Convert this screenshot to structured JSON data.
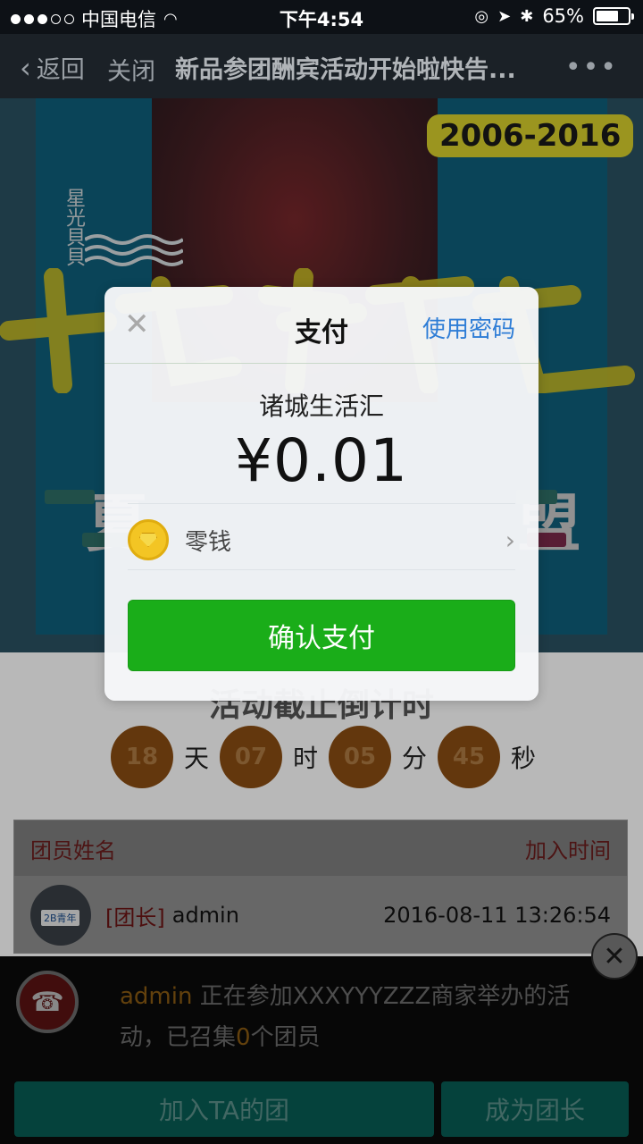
{
  "status_bar": {
    "carrier": "中国电信",
    "time": "下午4:54",
    "battery": "65%"
  },
  "nav": {
    "back_label": "返回",
    "close_label": "关闭",
    "title": "新品参团酬宾活动开始啦快告...",
    "more": "•••"
  },
  "banner": {
    "brand": "星光貝貝",
    "years": "2006-2016",
    "left_char": "夏",
    "right_char": "盟"
  },
  "countdown": {
    "title": "活动截止倒计时",
    "days": "18",
    "days_unit": "天",
    "hours": "07",
    "hours_unit": "时",
    "minutes": "05",
    "minutes_unit": "分",
    "seconds": "45",
    "seconds_unit": "秒"
  },
  "members": {
    "col_name": "团员姓名",
    "col_time": "加入时间",
    "rows": [
      {
        "tag": "[团长]",
        "name": "admin",
        "time": "2016-08-11 13:26:54",
        "avatar_tag": "2B青年"
      }
    ]
  },
  "bottom": {
    "user": "admin",
    "notice_text": "正在参加XXXYYYZZZ商家举办的活动，已召集",
    "count": "0",
    "notice_suffix": "个团员",
    "join_label": "加入TA的团",
    "leader_label": "成为团长"
  },
  "modal": {
    "title": "支付",
    "use_password": "使用密码",
    "merchant": "诸城生活汇",
    "amount": "¥0.01",
    "method": "零钱",
    "confirm": "确认支付"
  },
  "colors": {
    "confirm_green": "#1aad19",
    "link_blue": "#2e7dd6"
  }
}
